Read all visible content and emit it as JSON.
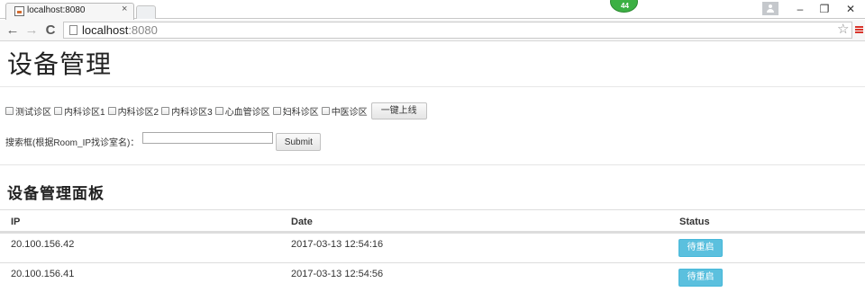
{
  "browser": {
    "tab_title": "localhost:8080",
    "tab_close": "×",
    "extension_badge_count": "44",
    "url_host": "localhost",
    "url_port": ":8080",
    "window_minimize": "–",
    "window_restore": "❐",
    "window_close": "✕",
    "icons": [
      "favicon-icon",
      "new-tab-icon",
      "user-icon",
      "back-icon",
      "forward-icon",
      "reload-icon",
      "page-icon",
      "star-icon",
      "menu-icon"
    ]
  },
  "page": {
    "title": "设备管理",
    "checkboxes": [
      {
        "label": "测试诊区",
        "checked": false
      },
      {
        "label": "内科诊区1",
        "checked": false
      },
      {
        "label": "内科诊区2",
        "checked": false
      },
      {
        "label": "内科诊区3",
        "checked": false
      },
      {
        "label": "心血管诊区",
        "checked": false
      },
      {
        "label": "妇科诊区",
        "checked": false
      },
      {
        "label": "中医诊区",
        "checked": false
      }
    ],
    "online_button": "一键上线",
    "search_label": "搜索框(根据Room_IP找诊室名)：",
    "search_value": "",
    "submit_label": "Submit",
    "panel_title": "设备管理面板",
    "table": {
      "headers": [
        "IP",
        "Date",
        "Status"
      ],
      "rows": [
        {
          "ip": "20.100.156.42",
          "date": "2017-03-13 12:54:16",
          "status": "待重启"
        },
        {
          "ip": "20.100.156.41",
          "date": "2017-03-13 12:54:56",
          "status": "待重启"
        }
      ]
    }
  },
  "colors": {
    "status_button": "#5bc0de",
    "extension_badge": "#3cb043",
    "menu_accent": "#d9352b"
  }
}
